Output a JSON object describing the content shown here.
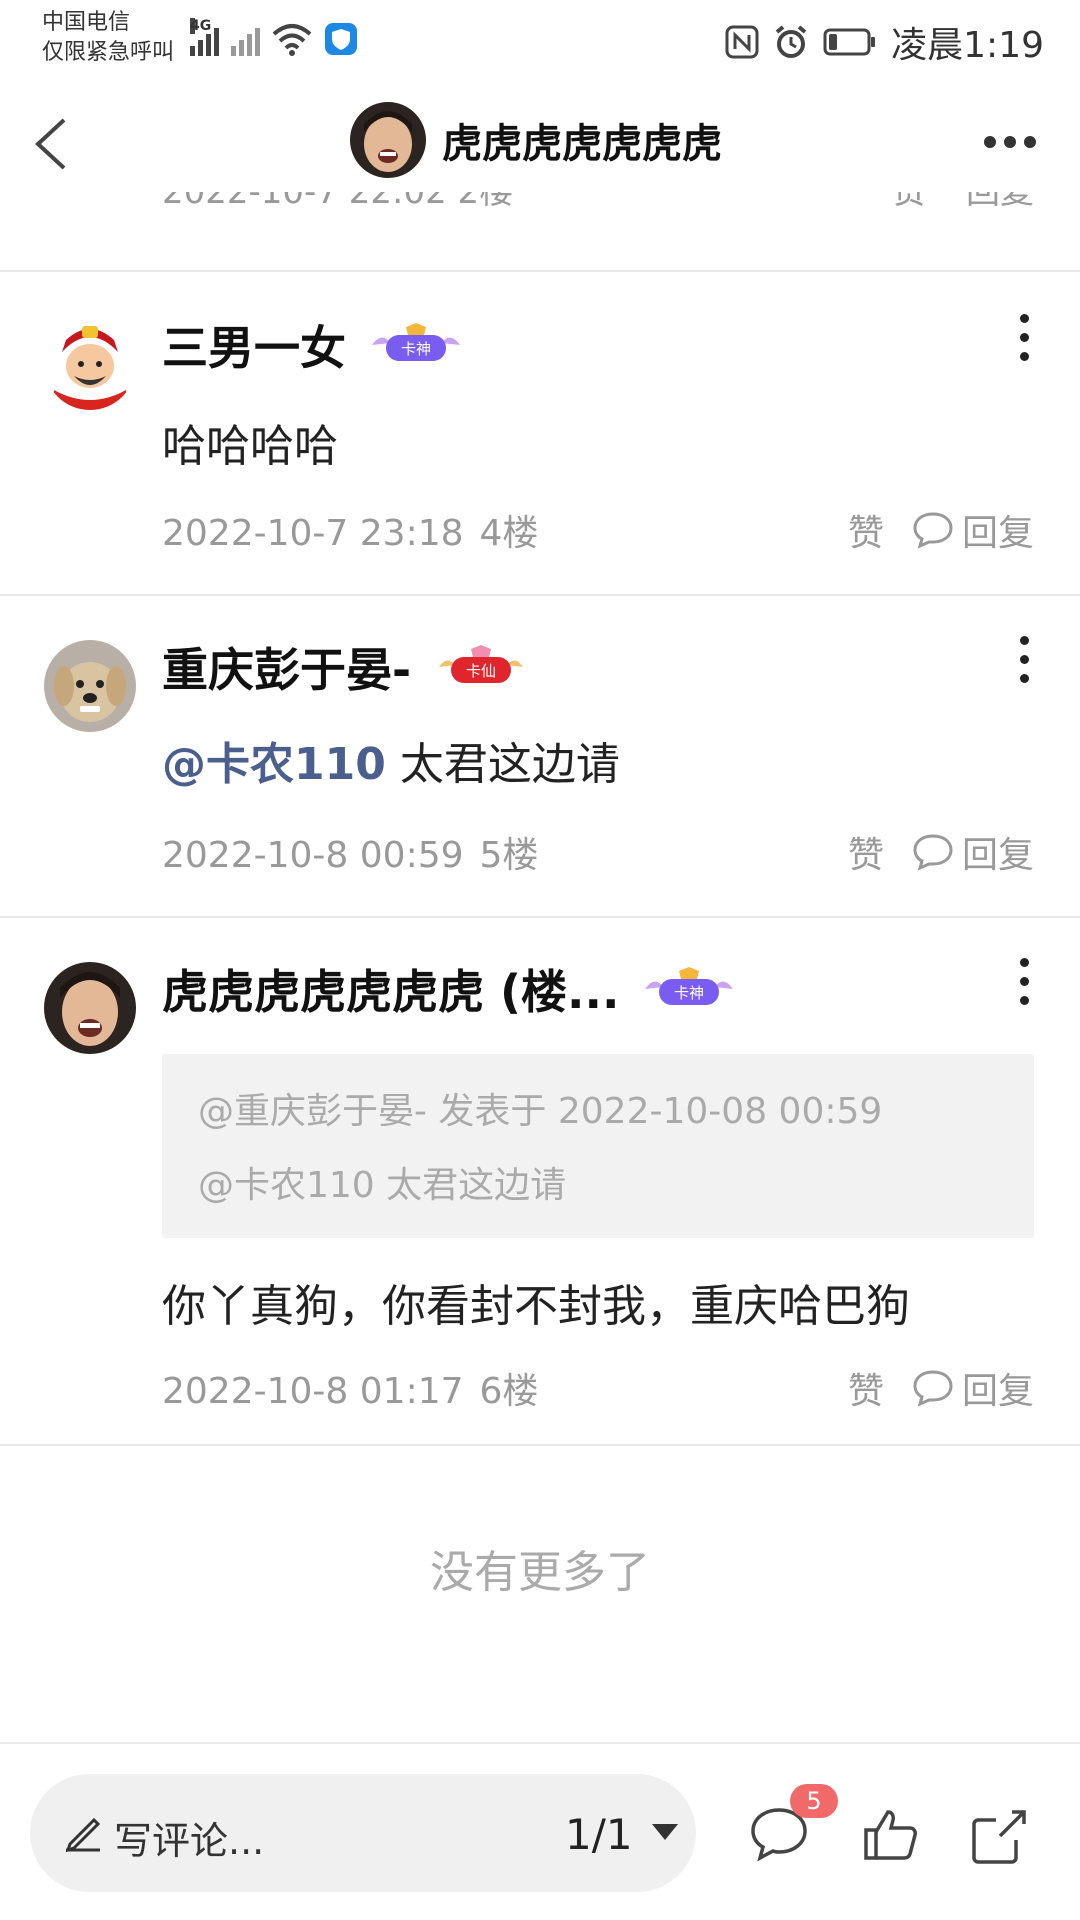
{
  "status_bar": {
    "carrier_line1": "中国电信",
    "carrier_line2": "仅限紧急呼叫",
    "network": "4G",
    "time": "凌晨1:19"
  },
  "header": {
    "title": "虎虎虎虎虎虎虎"
  },
  "comments": [
    {
      "name": "三男一女",
      "badge": "卡神",
      "text": "哈哈哈哈",
      "time": "2022-10-7 23:18",
      "floor": "4楼"
    },
    {
      "name": "重庆彭于晏-",
      "badge": "卡仙",
      "mention": "@卡农110",
      "text": " 太君这边请",
      "time": "2022-10-8 00:59",
      "floor": "5楼"
    },
    {
      "name": "虎虎虎虎虎虎虎 (楼...",
      "badge": "卡神",
      "quote_line1": "@重庆彭于晏- 发表于 2022-10-08 00:59",
      "quote_line2": "@卡农110 太君这边请",
      "text": "你丫真狗，你看封不封我，重庆哈巴狗",
      "time": "2022-10-8 01:17",
      "floor": "6楼"
    }
  ],
  "actions": {
    "like": "赞",
    "reply": "回复"
  },
  "end_text": "没有更多了",
  "bottom_bar": {
    "input_placeholder": "写评论...",
    "pager": "1/1",
    "comment_count": "5"
  },
  "colors": {
    "mention": "#4a5f8e",
    "badge_red": "#f06a6a",
    "divider": "#e8e8e8"
  }
}
